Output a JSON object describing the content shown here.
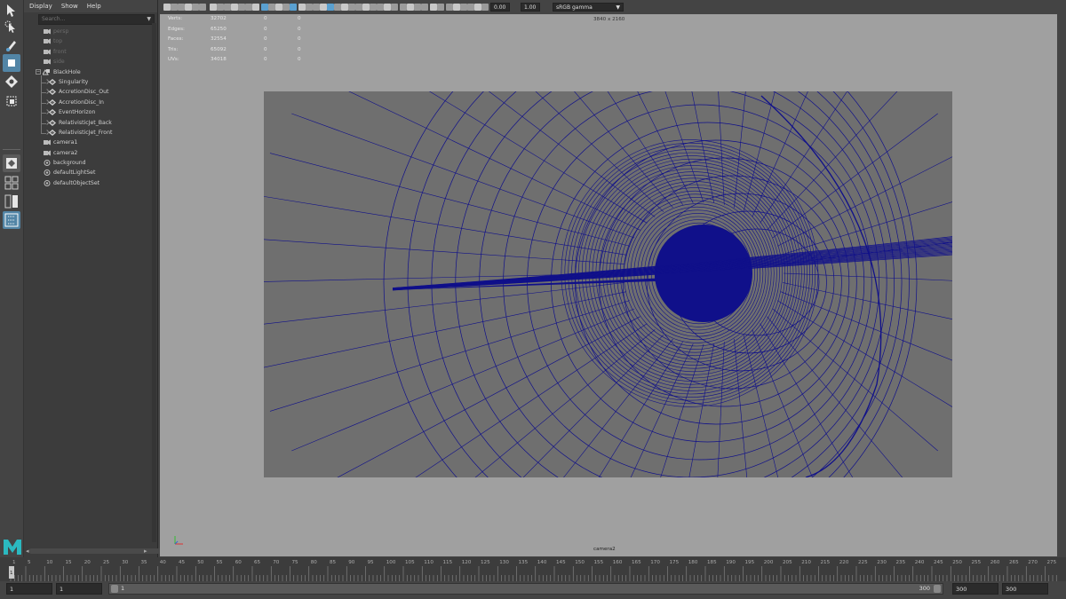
{
  "outliner": {
    "menu": [
      "Display",
      "Show",
      "Help"
    ],
    "search_placeholder": "Search...",
    "items": [
      {
        "label": "persp",
        "dim": true,
        "icon": "camera"
      },
      {
        "label": "top",
        "dim": true,
        "icon": "camera"
      },
      {
        "label": "front",
        "dim": true,
        "icon": "camera"
      },
      {
        "label": "side",
        "dim": true,
        "icon": "camera"
      },
      {
        "label": "BlackHole",
        "dim": false,
        "icon": "group"
      },
      {
        "label": "Singularity",
        "dim": false,
        "icon": "mesh"
      },
      {
        "label": "AccretionDisc_Out",
        "dim": false,
        "icon": "mesh"
      },
      {
        "label": "AccretionDisc_In",
        "dim": false,
        "icon": "mesh"
      },
      {
        "label": "EventHorizon",
        "dim": false,
        "icon": "mesh"
      },
      {
        "label": "RelativisticJet_Back",
        "dim": false,
        "icon": "mesh"
      },
      {
        "label": "RelativisticJet_Front",
        "dim": false,
        "icon": "mesh"
      },
      {
        "label": "camera1",
        "dim": false,
        "icon": "camera"
      },
      {
        "label": "camera2",
        "dim": false,
        "icon": "camera"
      },
      {
        "label": "background",
        "dim": false,
        "icon": "set"
      },
      {
        "label": "defaultLightSet",
        "dim": false,
        "icon": "set"
      },
      {
        "label": "defaultObjectSet",
        "dim": false,
        "icon": "set"
      }
    ]
  },
  "viewport": {
    "exposure": "0.00",
    "gamma": "1.00",
    "color_space": "sRGB gamma",
    "resolution": "3840 x 2160",
    "camera": "camera2",
    "hud": [
      {
        "label": "Verts:",
        "a": "32702",
        "b": "0",
        "c": "0"
      },
      {
        "label": "Edges:",
        "a": "65250",
        "b": "0",
        "c": "0"
      },
      {
        "label": "Faces:",
        "a": "32554",
        "b": "0",
        "c": "0"
      },
      {
        "label": "Tris:",
        "a": "65092",
        "b": "0",
        "c": "0"
      },
      {
        "label": "UVs:",
        "a": "34018",
        "b": "0",
        "c": "0"
      }
    ],
    "wire_color": "#10108a",
    "gate_color": "#6f6f6f",
    "background_color": "#a0a0a0"
  },
  "timeline": {
    "ticks": [
      "1",
      "5",
      "10",
      "15",
      "20",
      "25",
      "30",
      "35",
      "40",
      "45",
      "50",
      "55",
      "60",
      "65",
      "70",
      "75",
      "80",
      "85",
      "90",
      "95",
      "100",
      "105",
      "110",
      "115",
      "120",
      "125",
      "130",
      "135",
      "140",
      "145",
      "150",
      "155",
      "160",
      "165",
      "170",
      "175",
      "180",
      "185",
      "190",
      "195",
      "200",
      "205",
      "210",
      "215",
      "220",
      "225",
      "230",
      "235",
      "240",
      "245",
      "250",
      "255",
      "260",
      "265",
      "270",
      "275"
    ],
    "current_frame": "1",
    "range_start": "1",
    "playback_start": "1",
    "range_bar_start": "1",
    "range_bar_end": "300",
    "playback_end": "300",
    "range_end": "300"
  }
}
